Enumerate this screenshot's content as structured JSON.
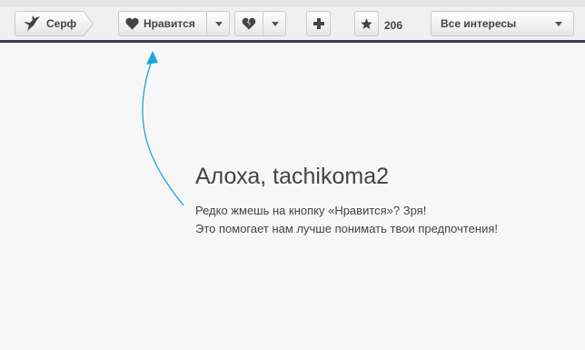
{
  "toolbar": {
    "surf_label": "Серф",
    "like_label": "Нравится",
    "star_count": "206",
    "interests_select": "Все интересы"
  },
  "icons": {
    "surf": "bird-icon",
    "like": "heart-icon",
    "dislike": "broken-heart-icon",
    "add": "plus-icon",
    "star": "star-icon",
    "dropdown": "chevron-down-icon"
  },
  "welcome": {
    "greeting": "Алоха, tachikoma2",
    "line1": "Редко жмешь на кнопку «Нравится»? Зря!",
    "line2": "Это помогает нам лучше понимать твои предпочтения!"
  },
  "colors": {
    "toolbar_border": "#3a3f4d",
    "arrow": "#19a8e0",
    "background": "#f7f7f7"
  }
}
